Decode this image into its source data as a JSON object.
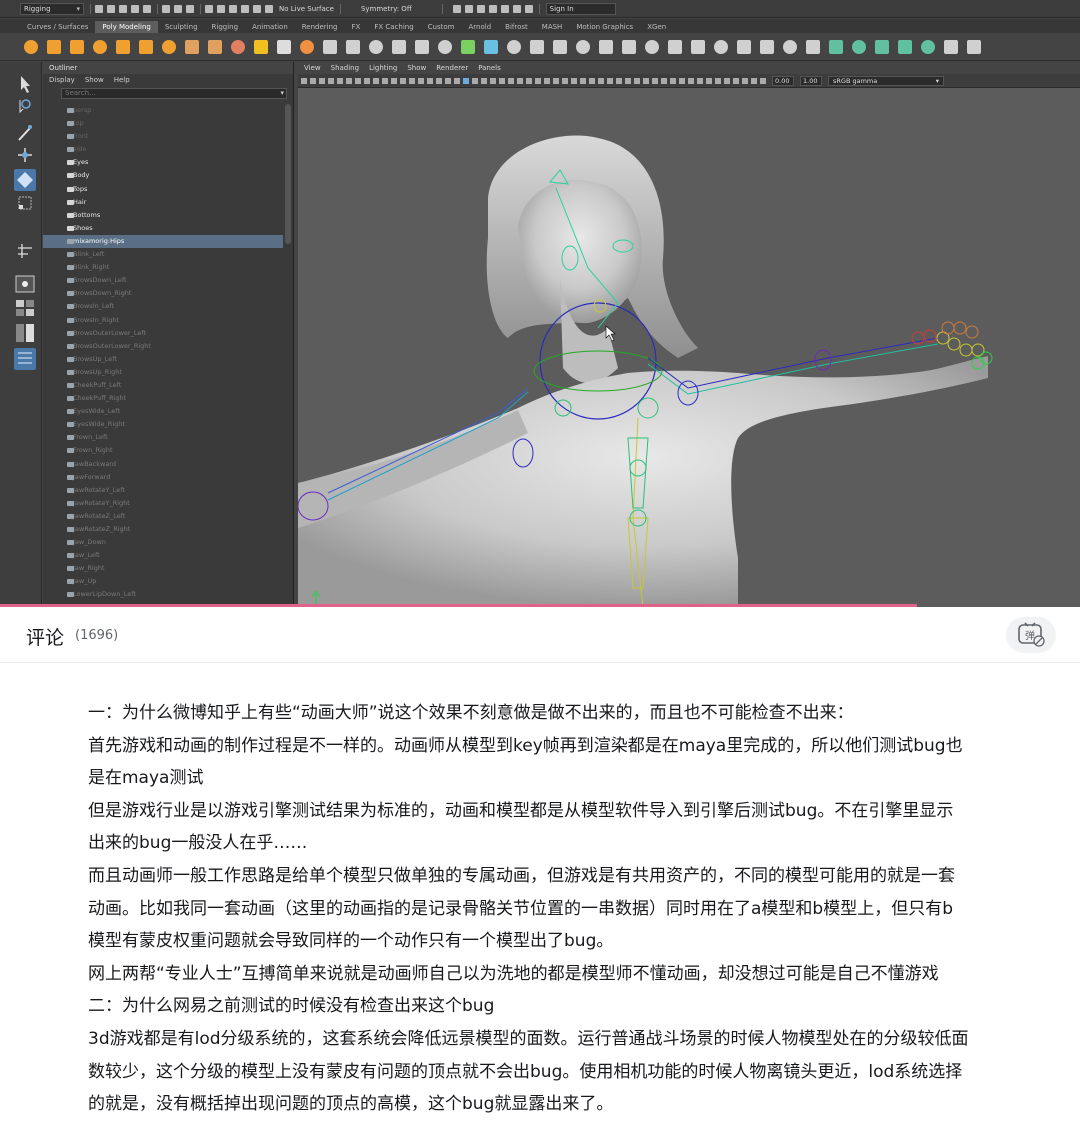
{
  "maya": {
    "mode": "Rigging",
    "live_surface": "No Live Surface",
    "symmetry": "Symmetry: Off",
    "sign_in": "Sign In",
    "shelf_tabs": [
      "Curves / Surfaces",
      "Poly Modeling",
      "Sculpting",
      "Rigging",
      "Animation",
      "Rendering",
      "FX",
      "FX Caching",
      "Custom",
      "Arnold",
      "Bifrost",
      "MASH",
      "Motion Graphics",
      "XGen"
    ],
    "outliner": {
      "title": "Outliner",
      "menu": [
        "Display",
        "Show",
        "Help"
      ],
      "search_placeholder": "Search...",
      "items": [
        {
          "label": "persp",
          "kind": "cam"
        },
        {
          "label": "top",
          "kind": "cam"
        },
        {
          "label": "front",
          "kind": "cam"
        },
        {
          "label": "side",
          "kind": "cam"
        },
        {
          "label": "Eyes",
          "kind": "group"
        },
        {
          "label": "Body",
          "kind": "group"
        },
        {
          "label": "Tops",
          "kind": "group"
        },
        {
          "label": "Hair",
          "kind": "group"
        },
        {
          "label": "Bottoms",
          "kind": "group"
        },
        {
          "label": "Shoes",
          "kind": "group"
        },
        {
          "label": "mixamorig:Hips",
          "kind": "sel"
        },
        {
          "label": "Blink_Left",
          "kind": "blend"
        },
        {
          "label": "Blink_Right",
          "kind": "blend"
        },
        {
          "label": "BrowsDown_Left",
          "kind": "blend"
        },
        {
          "label": "BrowsDown_Right",
          "kind": "blend"
        },
        {
          "label": "BrowsIn_Left",
          "kind": "blend"
        },
        {
          "label": "BrowsIn_Right",
          "kind": "blend"
        },
        {
          "label": "BrowsOuterLower_Left",
          "kind": "blend"
        },
        {
          "label": "BrowsOuterLower_Right",
          "kind": "blend"
        },
        {
          "label": "BrowsUp_Left",
          "kind": "blend"
        },
        {
          "label": "BrowsUp_Right",
          "kind": "blend"
        },
        {
          "label": "CheekPuff_Left",
          "kind": "blend"
        },
        {
          "label": "CheekPuff_Right",
          "kind": "blend"
        },
        {
          "label": "EyesWide_Left",
          "kind": "blend"
        },
        {
          "label": "EyesWide_Right",
          "kind": "blend"
        },
        {
          "label": "Frown_Left",
          "kind": "blend"
        },
        {
          "label": "Frown_Right",
          "kind": "blend"
        },
        {
          "label": "JawBackward",
          "kind": "blend"
        },
        {
          "label": "JawForward",
          "kind": "blend"
        },
        {
          "label": "JawRotateY_Left",
          "kind": "blend"
        },
        {
          "label": "JawRotateY_Right",
          "kind": "blend"
        },
        {
          "label": "JawRotateZ_Left",
          "kind": "blend"
        },
        {
          "label": "JawRotateZ_Right",
          "kind": "blend"
        },
        {
          "label": "Jaw_Down",
          "kind": "blend"
        },
        {
          "label": "Jaw_Left",
          "kind": "blend"
        },
        {
          "label": "Jaw_Right",
          "kind": "blend"
        },
        {
          "label": "Jaw_Up",
          "kind": "blend"
        },
        {
          "label": "LowerLipDown_Left",
          "kind": "blend"
        }
      ]
    },
    "viewport": {
      "menu": [
        "View",
        "Shading",
        "Lighting",
        "Show",
        "Renderer",
        "Panels"
      ],
      "value_a": "0.00",
      "value_b": "1.00",
      "color_space": "sRGB gamma"
    }
  },
  "comments": {
    "title": "评论",
    "count": "(1696)",
    "lines": [
      "一：为什么微博知乎上有些“动画大师”说这个效果不刻意做是做不出来的，而且也不可能检查不出来：",
      "首先游戏和动画的制作过程是不一样的。动画师从模型到key帧再到渲染都是在maya里完成的，所以他们测试bug也",
      "是在maya测试",
      "但是游戏行业是以游戏引擎测试结果为标准的，动画和模型都是从模型软件导入到引擎后测试bug。不在引擎里显示",
      "出来的bug一般没人在乎……",
      "而且动画师一般工作思路是给单个模型只做单独的专属动画，但游戏是有共用资产的，不同的模型可能用的就是一套",
      "动画。比如我同一套动画（这里的动画指的是记录骨骼关节位置的一串数据）同时用在了a模型和b模型上，但只有b",
      "模型有蒙皮权重问题就会导致同样的一个动作只有一个模型出了bug。",
      "网上两帮“专业人士”互搏简单来说就是动画师自己以为洗地的都是模型师不懂动画，却没想过可能是自己不懂游戏",
      "二：为什么网易之前测试的时候没有检查出来这个bug",
      "3d游戏都是有lod分级系统的，这套系统会降低远景模型的面数。运行普通战斗场景的时候人物模型处在的分级较低面",
      "数较少，这个分级的模型上没有蒙皮有问题的顶点就不会出bug。使用相机功能的时候人物离镜头更近，lod系统选择",
      "的就是，没有概括掉出现问题的顶点的高模，这个bug就显露出来了。"
    ]
  }
}
